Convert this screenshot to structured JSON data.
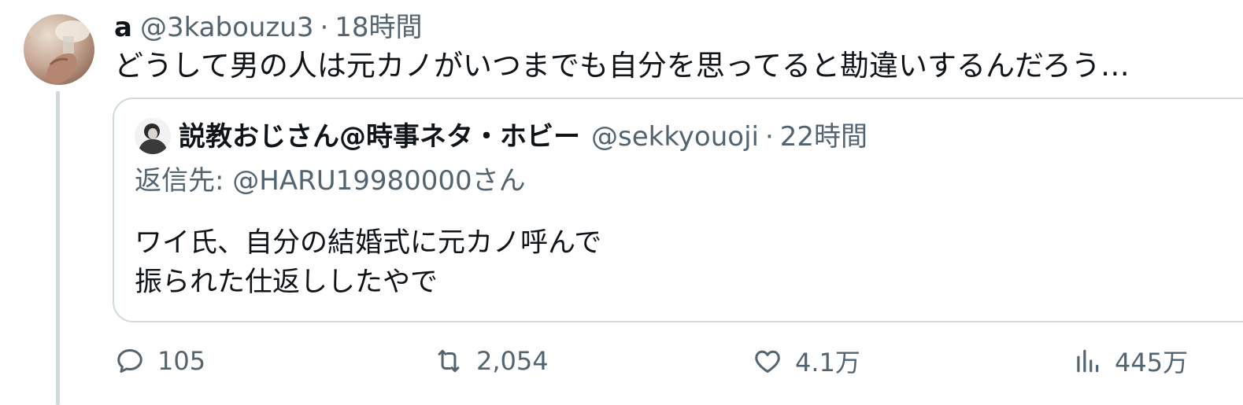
{
  "tweet": {
    "author_name": "a",
    "author_handle": "@3kabouzu3",
    "separator": "·",
    "time": "18時間",
    "text": "どうして男の人は元カノがいつまでも自分を思ってると勘違いするんだろう…"
  },
  "quote": {
    "author_name": "説教おじさん@時事ネタ・ホビー",
    "author_handle": "@sekkyouoji",
    "separator": "·",
    "time": "22時間",
    "reply_to": "返信先: @HARU19980000さん",
    "body_lines": [
      "ワイ氏、自分の結婚式に元カノ呼んで",
      "振られた仕返ししたやで"
    ]
  },
  "actions": {
    "replies": "105",
    "retweets": "2,054",
    "likes": "4.1万",
    "views": "445万"
  },
  "icons": {
    "reply": "speech-bubble-icon",
    "retweet": "retweet-arrows-icon",
    "like": "heart-icon",
    "views": "bar-chart-icon"
  },
  "colors": {
    "text": "#0f1419",
    "secondary": "#536471",
    "border": "#cfd9de"
  }
}
